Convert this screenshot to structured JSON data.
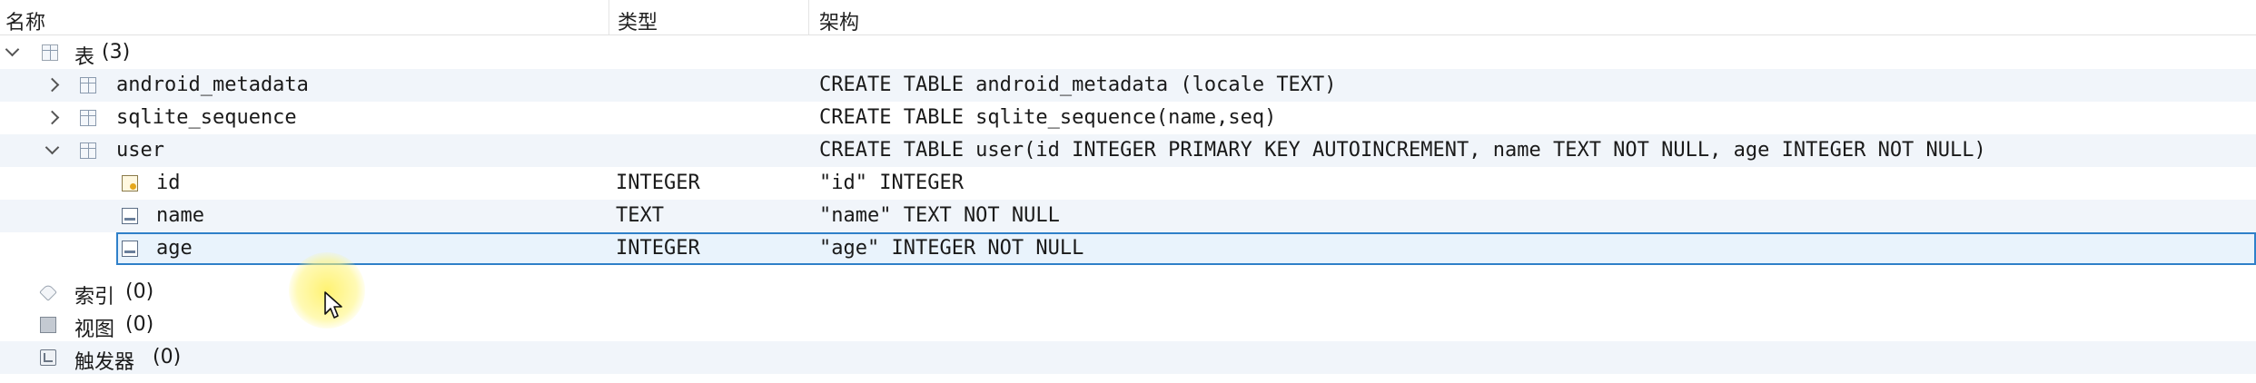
{
  "header": {
    "columns": [
      "名称",
      "类型",
      "架构"
    ]
  },
  "tree": {
    "tables_group": {
      "label": "表",
      "count": "(3)"
    },
    "tables": [
      {
        "name": "android_metadata",
        "schema": "CREATE TABLE android_metadata (locale TEXT)"
      },
      {
        "name": "sqlite_sequence",
        "schema": "CREATE TABLE sqlite_sequence(name,seq)"
      },
      {
        "name": "user",
        "schema": "CREATE TABLE user(id INTEGER PRIMARY KEY AUTOINCREMENT, name TEXT NOT NULL, age INTEGER NOT NULL)"
      }
    ],
    "user_fields": [
      {
        "name": "id",
        "type": "INTEGER",
        "schema": "\"id\" INTEGER",
        "icon": "primary-key-field-icon"
      },
      {
        "name": "name",
        "type": "TEXT",
        "schema": "\"name\" TEXT NOT NULL",
        "icon": "field-icon"
      },
      {
        "name": "age",
        "type": "INTEGER",
        "schema": "\"age\" INTEGER NOT NULL",
        "icon": "field-icon",
        "selected": true
      }
    ],
    "indexes_group": {
      "label": "索引",
      "count": "(0)"
    },
    "views_group": {
      "label": "视图",
      "count": "(0)"
    },
    "triggers_group": {
      "label": "触发器",
      "count": "(0)"
    }
  },
  "colors": {
    "selection_border": "#2f80c9",
    "selection_fill": "#e9f3fc",
    "alt_row": "#f1f5fa"
  }
}
